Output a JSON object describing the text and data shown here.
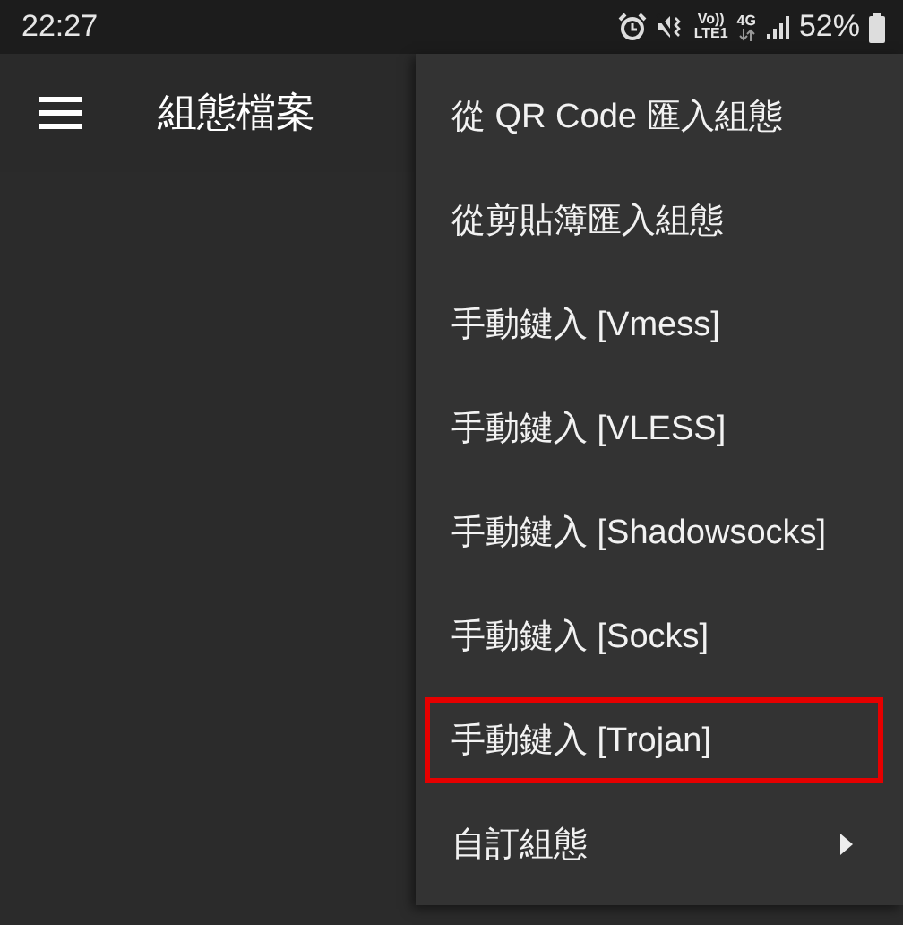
{
  "status_bar": {
    "time": "22:27",
    "volte": "Vo))",
    "lte": "LTE1",
    "network": "4G",
    "battery": "52%"
  },
  "app_bar": {
    "title": "組態檔案"
  },
  "menu": {
    "items": [
      {
        "label": "從 QR Code 匯入組態",
        "kind": "action",
        "highlighted": false
      },
      {
        "label": "從剪貼簿匯入組態",
        "kind": "action",
        "highlighted": false
      },
      {
        "label": "手動鍵入 [Vmess]",
        "kind": "action",
        "highlighted": false
      },
      {
        "label": "手動鍵入 [VLESS]",
        "kind": "action",
        "highlighted": false
      },
      {
        "label": "手動鍵入 [Shadowsocks]",
        "kind": "action",
        "highlighted": false
      },
      {
        "label": "手動鍵入 [Socks]",
        "kind": "action",
        "highlighted": false
      },
      {
        "label": "手動鍵入 [Trojan]",
        "kind": "action",
        "highlighted": true
      },
      {
        "label": "自訂組態",
        "kind": "submenu",
        "highlighted": false
      }
    ]
  }
}
